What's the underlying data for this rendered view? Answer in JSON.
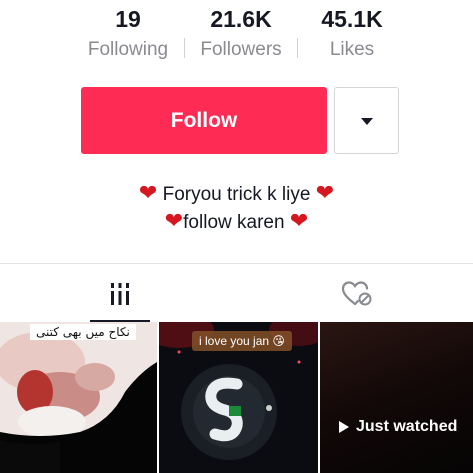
{
  "stats": {
    "following": {
      "value": "19",
      "label": "Following"
    },
    "followers": {
      "value": "21.6K",
      "label": "Followers"
    },
    "likes": {
      "value": "45.1K",
      "label": "Likes"
    }
  },
  "actions": {
    "follow_label": "Follow"
  },
  "bio": {
    "line1": "Foryou trick k liye",
    "line2": "follow karen"
  },
  "tabs": [
    "videos-grid",
    "liked"
  ],
  "videos": [
    {
      "caption": "نکاح میں بھی کتنی"
    },
    {
      "caption": "i love you jan 😘"
    },
    {
      "overlay": "Just watched"
    }
  ],
  "colors": {
    "accent": "#fe2c55",
    "heart": "#d6171f",
    "secondary_text": "#8a8b91"
  }
}
